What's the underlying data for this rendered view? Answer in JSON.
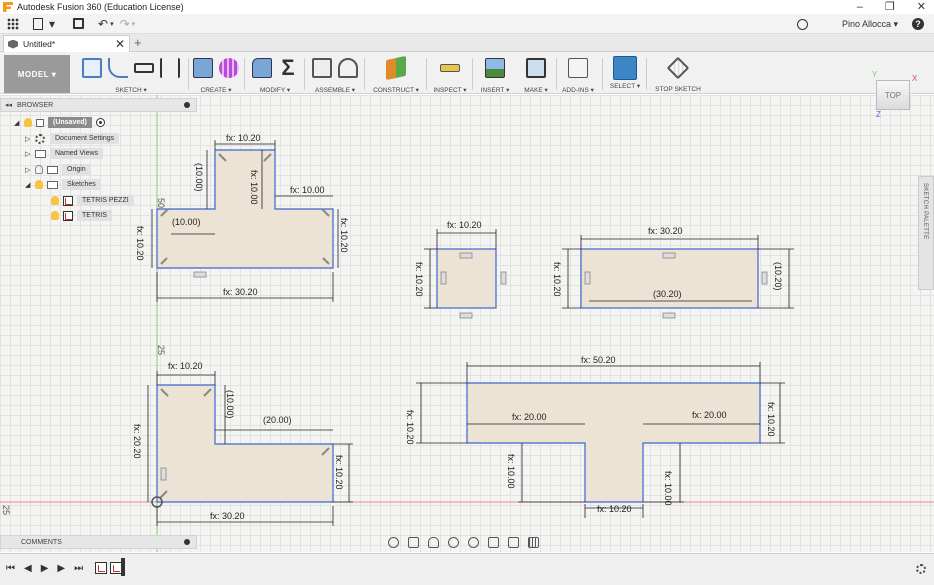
{
  "window": {
    "title": "Autodesk Fusion 360 (Education License)",
    "buttons": [
      "–",
      "❐",
      "✕"
    ]
  },
  "quickbar": {
    "user": "Pino Allocca ▾",
    "help": "?"
  },
  "document": {
    "tab_name": "Untitled*",
    "close": "✕",
    "new_tab": "+"
  },
  "toolbar": {
    "workspace": "MODEL ▾",
    "groups": [
      "SKETCH ▾",
      "CREATE ▾",
      "MODIFY ▾",
      "ASSEMBLE ▾",
      "CONSTRUCT ▾",
      "INSPECT ▾",
      "INSERT ▾",
      "MAKE ▾",
      "ADD-INS ▾",
      "SELECT ▾",
      "STOP SKETCH"
    ]
  },
  "browser": {
    "label": "BROWSER",
    "root": "(Unsaved)",
    "items": [
      "Document Settings",
      "Named Views",
      "Origin",
      "Sketches",
      "TETRIS PEZZI",
      "TETRIS"
    ]
  },
  "viewcube": {
    "face": "TOP",
    "x": "X",
    "y": "Y",
    "z": "Z"
  },
  "sketch_palette": "SKETCH PALETTE",
  "comments": "COMMENTS",
  "dimensions": {
    "t1_top": "fx: 10.20",
    "t1_stem_h": "(10.00)",
    "t1_stem_in": "fx: 10.00",
    "t1_right": "fx: 10.00",
    "t1_left_ref": "(10.00)",
    "t1_left_h": "fx: 10.20",
    "t1_right_h": "fx: 10.20",
    "t1_bottom": "fx: 30.20",
    "t1_axis_label": "50",
    "sq_top": "fx: 10.20",
    "sq_left": "fx: 10.20",
    "rect_top": "fx: 30.20",
    "rect_left": "fx: 10.20",
    "rect_right": "(10.20)",
    "rect_inner": "(30.20)",
    "l_top": "fx: 10.20",
    "l_stem": "(10.00)",
    "l_inner": "(20.00)",
    "l_left": "fx: 20.20",
    "l_right": "fx: 10.20",
    "l_bottom": "fx: 30.20",
    "l_axis_label": "25",
    "bt_top": "fx: 50.20",
    "bt_left_in": "fx: 20.00",
    "bt_right_in": "fx: 20.00",
    "bt_left": "fx: 10.20",
    "bt_right": "fx: 10.20",
    "bt_stem_left": "fx: 10.00",
    "bt_stem_right": "fx: 10.00",
    "bt_bottom": "fx: 10.20",
    "origin_label": "25"
  }
}
